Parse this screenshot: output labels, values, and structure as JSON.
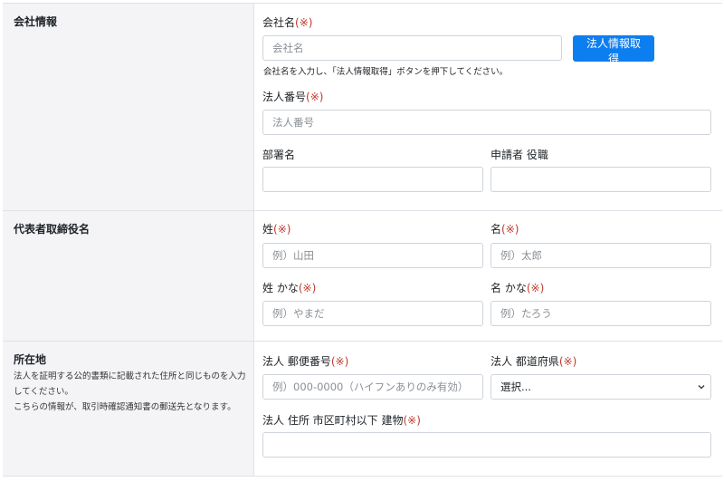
{
  "required_mark": "(※)",
  "company": {
    "section_title": "会社情報",
    "name_label": "会社名",
    "name_placeholder": "会社名",
    "fetch_button": "法人情報取得",
    "help_text": "会社名を入力し、「法人情報取得」ボタンを押下してください。",
    "corp_number_label": "法人番号",
    "corp_number_placeholder": "法人番号",
    "department_label": "部署名",
    "applicant_title_label": "申請者 役職"
  },
  "representative": {
    "section_title": "代表者取締役名",
    "last_name_label": "姓",
    "last_name_placeholder": "例）山田",
    "first_name_label": "名",
    "first_name_placeholder": "例）太郎",
    "last_kana_label": "姓 かな",
    "last_kana_placeholder": "例）やまだ",
    "first_kana_label": "名 かな",
    "first_kana_placeholder": "例）たろう"
  },
  "address": {
    "section_title": "所在地",
    "desc_line1": "法人を証明する公的書類に記載された住所と同じものを入力してください。",
    "desc_line2": "こちらの情報が、取引時確認通知書の郵送先となります。",
    "postal_label": "法人 郵便番号",
    "postal_placeholder": "例）000-0000（ハイフンありのみ有効）",
    "prefecture_label": "法人 都道府県",
    "prefecture_selected": "選択...",
    "street_label": "法人 住所 市区町村以下 建物"
  },
  "colors": {
    "accent": "#0d7ef0",
    "required": "#c0392b",
    "label_bg": "#f4f4f6",
    "border": "#dee2e6"
  },
  "icons": {
    "select_arrow": "chevron-down-icon"
  }
}
